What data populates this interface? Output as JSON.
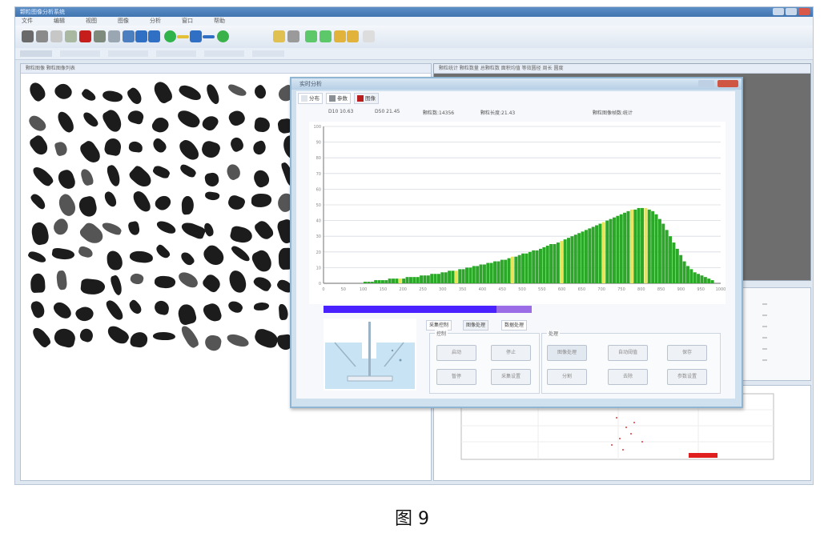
{
  "caption": "图 9",
  "window": {
    "title": "颗粒图像分析系统"
  },
  "menu": [
    "文件",
    "编辑",
    "视图",
    "图像",
    "分析",
    "窗口",
    "帮助"
  ],
  "toolbar_icons": [
    {
      "name": "print-icon",
      "color": "#6a6a6a"
    },
    {
      "name": "scanner-icon",
      "color": "#8a8a8a"
    },
    {
      "name": "document-icon",
      "color": "#c7c7c7"
    },
    {
      "name": "report-icon",
      "color": "#a9b8a0"
    },
    {
      "name": "stop-icon",
      "color": "#c61d1d"
    },
    {
      "name": "image-icon",
      "color": "#7e8b7c"
    },
    {
      "name": "refresh-icon",
      "color": "#9aa7b3"
    },
    {
      "name": "zoom-icon",
      "color": "#4c7fc0"
    },
    {
      "name": "arrow-up-icon",
      "color": "#2f6fc4"
    },
    {
      "name": "arrow-down-icon",
      "color": "#2f6fc4"
    },
    {
      "name": "ring-icon",
      "color": "#2fb34a"
    },
    {
      "name": "line-icon",
      "color": "#e3c036"
    },
    {
      "name": "plus-icon",
      "color": "#2f6fc4"
    },
    {
      "name": "minus-icon",
      "color": "#2f6fc4"
    },
    {
      "name": "globe-icon",
      "color": "#3bb14a"
    },
    {
      "name": "settings-icon",
      "color": "#e0c050"
    },
    {
      "name": "measure-icon",
      "color": "#9a9a9a"
    },
    {
      "name": "arrow-right-icon",
      "color": "#5cc86a"
    },
    {
      "name": "play-icon",
      "color": "#5cc86a"
    },
    {
      "name": "folder-icon",
      "color": "#e2b33a"
    },
    {
      "name": "save-icon",
      "color": "#e2b33a"
    },
    {
      "name": "help-icon",
      "color": "#dddddd"
    }
  ],
  "left_pane": {
    "header": "颗粒图像 颗粒图像列表"
  },
  "right_top": {
    "header": "颗粒统计 颗粒数量 总颗粒数 面积均值 等效圆径 周长 圆度"
  },
  "dialog": {
    "title": "实时分析",
    "tabs": [
      "分布",
      "参数",
      "图像"
    ],
    "info": [
      "D10 10.63",
      "D50 21.45",
      "颗粒数:14356",
      "颗粒长度:21.43",
      "颗粒图像帧数:统计"
    ],
    "y_ticks": [
      "100",
      "90",
      "80",
      "70",
      "60",
      "50",
      "40",
      "30",
      "20",
      "10",
      "0"
    ],
    "x_ticks": [
      "0",
      "50",
      "100",
      "150",
      "200",
      "250",
      "300",
      "350",
      "400",
      "450",
      "500",
      "550",
      "600",
      "650",
      "700",
      "750",
      "800",
      "850",
      "900",
      "950",
      "1000"
    ],
    "progress": 0.83,
    "control_tabs": [
      "采集控制",
      "图像处理",
      "数据处理"
    ],
    "group_left": "控制",
    "group_right": "处理",
    "buttons_left": [
      "启动",
      "停止",
      "暂停",
      "采集设置"
    ],
    "buttons_right": [
      "图像处理",
      "自动阈值",
      "保存",
      "分割",
      "去除",
      "参数设置"
    ]
  },
  "chart_data": {
    "type": "bar",
    "ylim": [
      0,
      100
    ],
    "xlim": [
      0,
      1000
    ],
    "bar_color": "#2ca829",
    "highlight_color": "#e8e55c",
    "values": [
      1,
      1,
      1,
      2,
      2,
      2,
      2,
      3,
      3,
      3,
      3,
      3,
      4,
      4,
      4,
      4,
      5,
      5,
      5,
      6,
      6,
      6,
      7,
      7,
      8,
      8,
      8,
      9,
      9,
      10,
      10,
      11,
      11,
      12,
      12,
      13,
      13,
      14,
      14,
      15,
      15,
      16,
      17,
      17,
      18,
      19,
      19,
      20,
      21,
      21,
      22,
      23,
      24,
      25,
      25,
      26,
      27,
      28,
      29,
      30,
      31,
      32,
      33,
      34,
      35,
      36,
      37,
      38,
      39,
      40,
      41,
      42,
      43,
      44,
      45,
      46,
      47,
      47,
      48,
      48,
      48,
      47,
      46,
      44,
      41,
      38,
      34,
      30,
      26,
      22,
      18,
      14,
      11,
      9,
      7,
      6,
      5,
      4,
      3,
      2
    ],
    "highlight_indices": [
      10,
      26,
      42,
      56,
      68,
      76,
      80
    ]
  }
}
